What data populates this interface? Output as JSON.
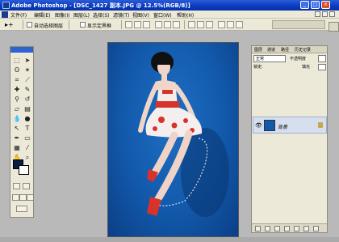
{
  "window": {
    "title": "Adobe Photoshop - [DSC_1427 副本.JPG @ 12.5%(RGB/8)]"
  },
  "menubar": {
    "items": [
      "文件(F)",
      "编辑(E)",
      "图像(I)",
      "图层(L)",
      "选择(S)",
      "滤镜(T)",
      "视图(V)",
      "窗口(W)",
      "帮助(H)"
    ]
  },
  "options": {
    "auto_select_layer": "自动选择图层",
    "show_bounding_box": "显示定界框"
  },
  "layers": {
    "tabs": [
      "图层",
      "通道",
      "路径",
      "历史记录"
    ],
    "blend_mode": "正常",
    "opacity_label": "不透明度",
    "lock_label": "锁定:",
    "fill_label": "填充",
    "layer_name": "背景"
  },
  "colors": {
    "foreground": "#071f45",
    "background": "#ffffff",
    "canvas_blue": "#1259ab"
  }
}
